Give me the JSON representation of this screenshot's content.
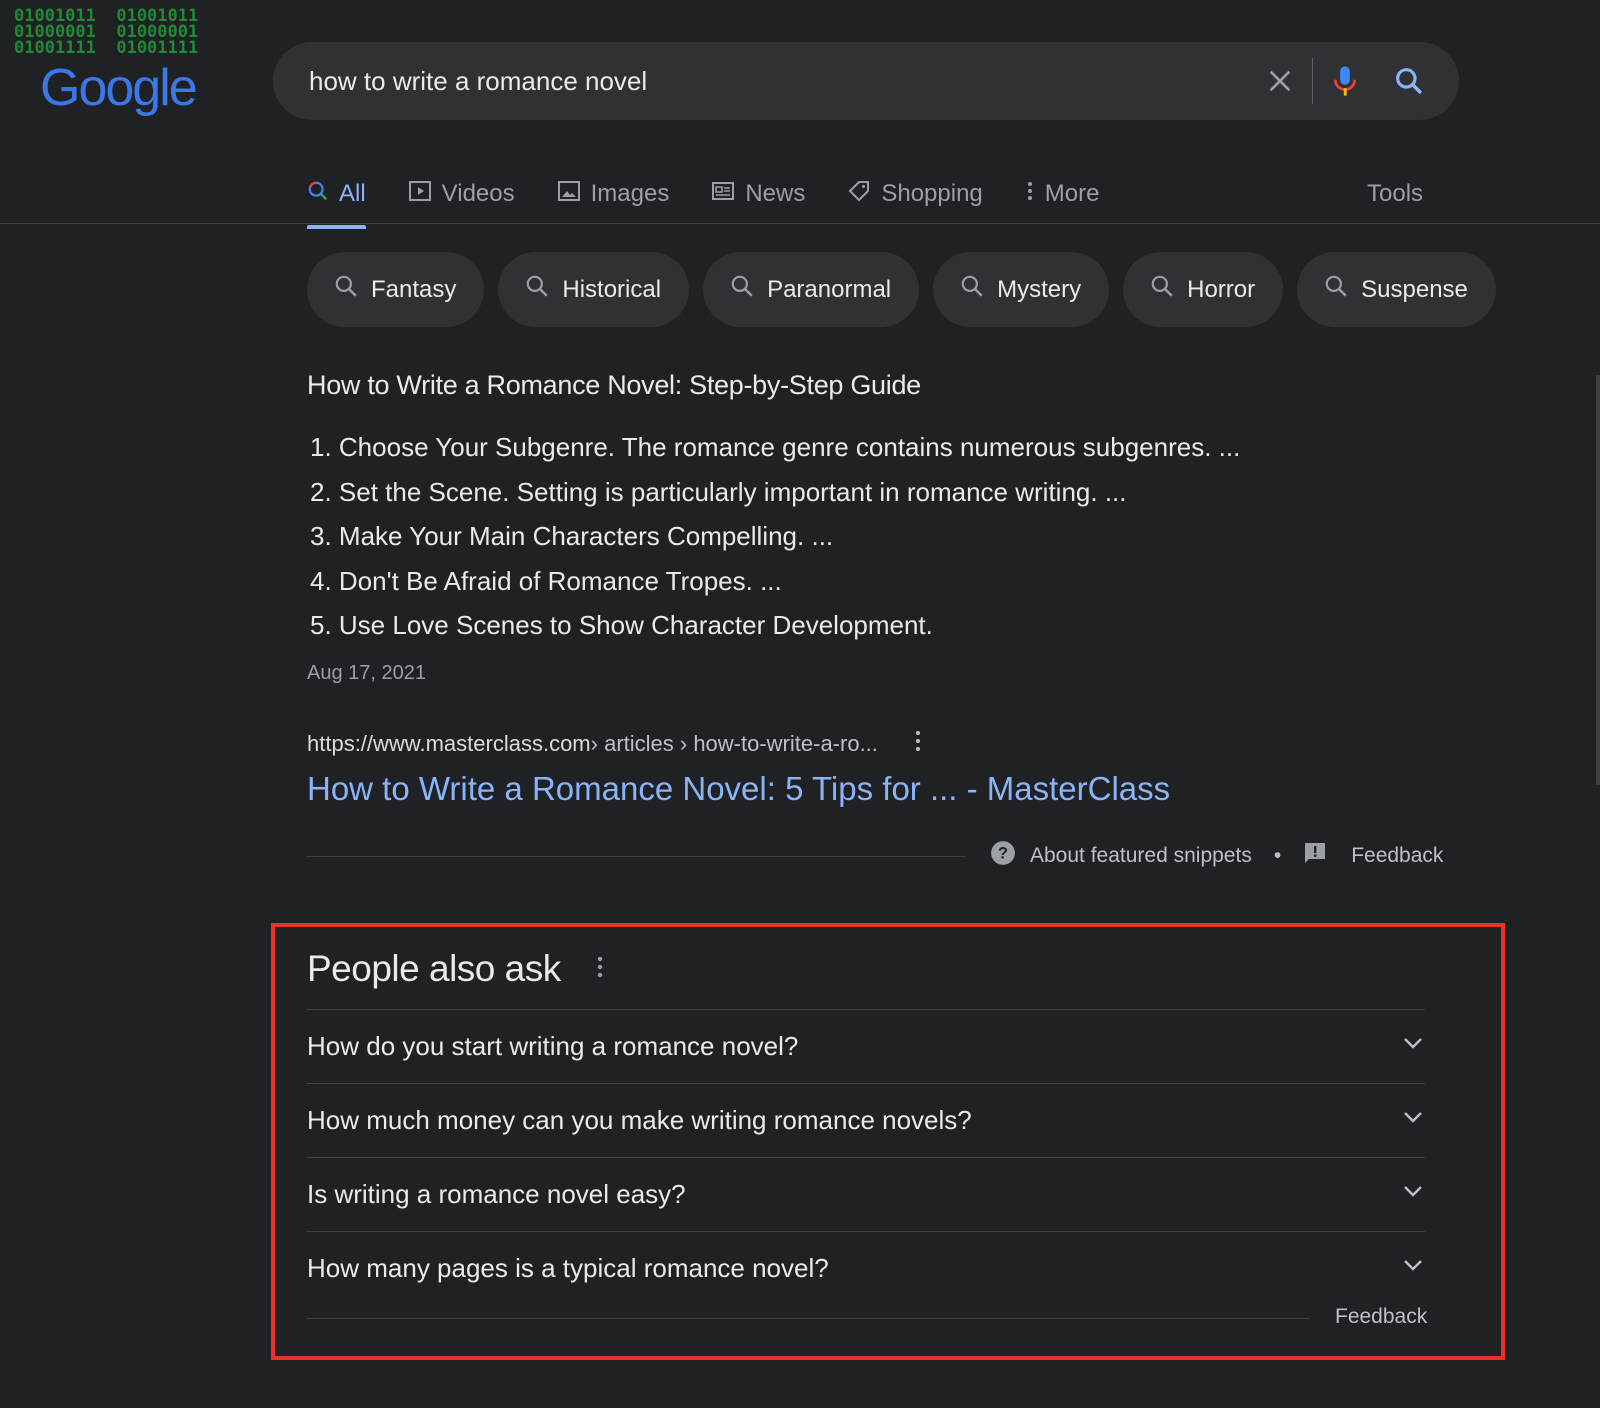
{
  "logo": {
    "binary": "01001011  01001011\n01000001  01000001\n01001111  01001111",
    "wordmark": "Google"
  },
  "search": {
    "query": "how to write a romance novel"
  },
  "tabs": [
    {
      "label": "All",
      "icon": "search-icon",
      "active": true
    },
    {
      "label": "Videos",
      "icon": "play-icon"
    },
    {
      "label": "Images",
      "icon": "image-icon"
    },
    {
      "label": "News",
      "icon": "newspaper-icon"
    },
    {
      "label": "Shopping",
      "icon": "tag-icon"
    },
    {
      "label": "More",
      "icon": "more-vert-icon"
    }
  ],
  "tools_label": "Tools",
  "chips": [
    "Fantasy",
    "Historical",
    "Paranormal",
    "Mystery",
    "Horror",
    "Suspense"
  ],
  "snippet": {
    "title": "How to Write a Romance Novel: Step-by-Step Guide",
    "steps": [
      "1. Choose Your Subgenre. The romance genre contains numerous subgenres. ...",
      "2. Set the Scene. Setting is particularly important in romance writing. ...",
      "3. Make Your Main Characters Compelling. ...",
      "4. Don't Be Afraid of Romance Tropes. ...",
      "5. Use Love Scenes to Show Character Development."
    ],
    "date": "Aug 17, 2021",
    "cite_domain": "https://www.masterclass.com",
    "cite_path": " › articles › how-to-write-a-ro...",
    "link": "How to Write a Romance Novel: 5 Tips for ... - MasterClass",
    "about": "About featured snippets",
    "bullet": "•",
    "feedback": "Feedback"
  },
  "paa": {
    "title": "People also ask",
    "questions": [
      "How do you start writing a romance novel?",
      "How much money can you make writing romance novels?",
      "Is writing a romance novel easy?",
      "How many pages is a typical romance novel?"
    ],
    "feedback": "Feedback"
  },
  "colors": {
    "background": "#202124",
    "link": "#8ab4f8",
    "highlight_box": "#e8322b"
  }
}
